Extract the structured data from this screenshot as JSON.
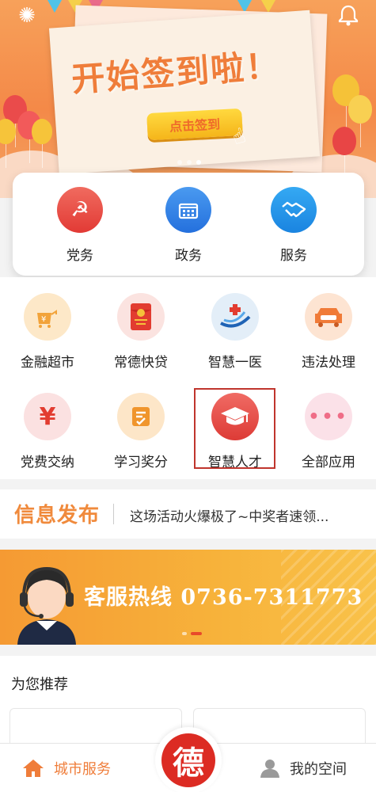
{
  "banner": {
    "headline": "开始签到啦！",
    "button_label": "点击签到",
    "carousel_count": 3,
    "carousel_active": 3
  },
  "services": [
    {
      "label": "党务",
      "icon": "party-emblem-icon",
      "color": "#e8413b"
    },
    {
      "label": "政务",
      "icon": "government-building-icon",
      "color": "#2f7de1"
    },
    {
      "label": "服务",
      "icon": "handshake-icon",
      "color": "#1f8fe6"
    }
  ],
  "apps": [
    {
      "label": "金融超市",
      "icon": "finance-icon"
    },
    {
      "label": "常德快贷",
      "icon": "red-envelope-icon"
    },
    {
      "label": "智慧一医",
      "icon": "hospital-logo-icon"
    },
    {
      "label": "违法处理",
      "icon": "traffic-car-icon"
    },
    {
      "label": "党费交纳",
      "icon": "yuan-icon"
    },
    {
      "label": "学习奖分",
      "icon": "study-checklist-icon"
    },
    {
      "label": "智慧人才",
      "icon": "graduation-cap-icon"
    },
    {
      "label": "全部应用",
      "icon": "more-dots-icon"
    }
  ],
  "news": {
    "title": "信息发布",
    "text": "这场活动火爆极了~中奖者速领..."
  },
  "hotline": {
    "text": "客服热线 0736-7311773"
  },
  "recommend": {
    "title": "为您推荐"
  },
  "tabbar": {
    "home_label": "城市服务",
    "center_label": "德",
    "profile_label": "我的空间"
  },
  "colors": {
    "accent": "#ef7d3a",
    "brand_red": "#dc2b23",
    "highlight_border": "#c0352d"
  }
}
